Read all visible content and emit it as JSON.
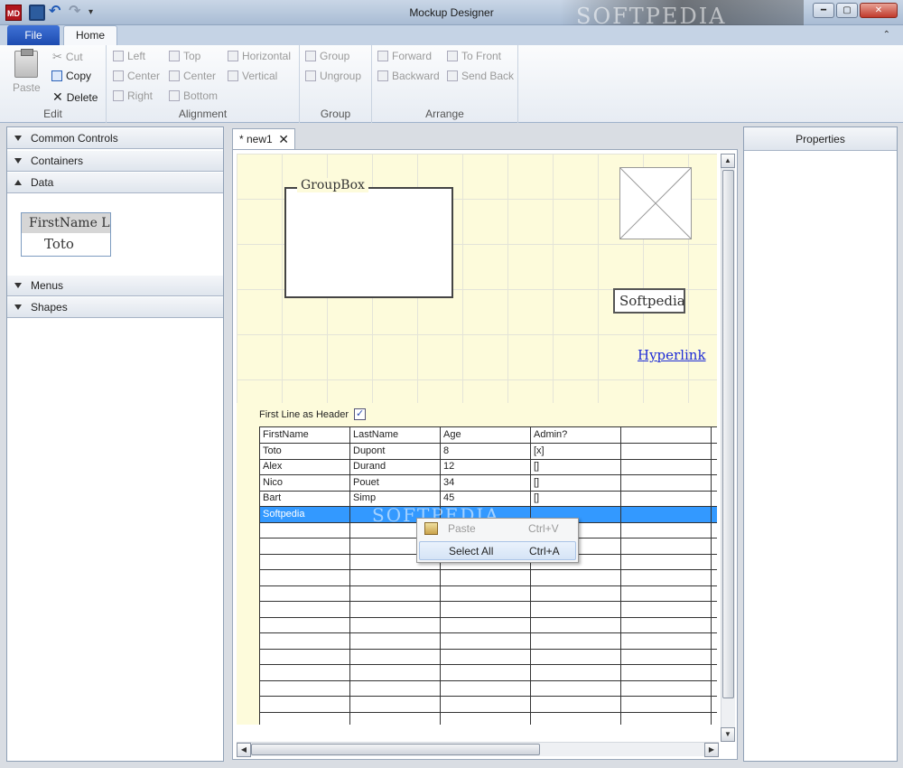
{
  "window": {
    "app_icon": "MD",
    "title": "Mockup Designer",
    "watermark": "SOFTPEDIA",
    "buttons": [
      "minimize",
      "maximize",
      "close"
    ]
  },
  "ribbon": {
    "tabs": [
      "File",
      "Home"
    ],
    "active_tab": "Home",
    "groups": {
      "edit": {
        "label": "Edit",
        "paste": "Paste",
        "cut": "Cut",
        "copy": "Copy",
        "delete": "Delete"
      },
      "alignment": {
        "label": "Alignment",
        "left": "Left",
        "center_h": "Center",
        "right": "Right",
        "top": "Top",
        "center_v": "Center",
        "bottom": "Bottom",
        "horizontal": "Horizontal",
        "vertical": "Vertical"
      },
      "group": {
        "label": "Group",
        "group": "Group",
        "ungroup": "Ungroup"
      },
      "arrange": {
        "label": "Arrange",
        "forward": "Forward",
        "backward": "Backward",
        "to_front": "To Front",
        "send_back": "Send Back"
      }
    }
  },
  "toolbox": {
    "sections": [
      "Common Controls",
      "Containers",
      "Data",
      "Menus",
      "Shapes"
    ],
    "expanded": "Data",
    "data_preview": {
      "header": "FirstName  L",
      "row": "Toto"
    }
  },
  "document": {
    "tab_label": "* new1",
    "tab_close": "✕",
    "groupbox_label": "GroupBox",
    "label_text": "Softpedia",
    "hyperlink_text": "Hyperlink",
    "first_line_header_label": "First Line as Header",
    "first_line_header_checked": true,
    "check_mark": "✓",
    "grid": {
      "rows": [
        [
          "FirstName",
          "LastName",
          "Age",
          "Admin?",
          ""
        ],
        [
          "Toto",
          "Dupont",
          "8",
          "[x]",
          ""
        ],
        [
          "Alex",
          "Durand",
          "12",
          "[]",
          ""
        ],
        [
          "Nico",
          "Pouet",
          "34",
          "[]",
          ""
        ],
        [
          "Bart",
          "Simp",
          "45",
          "[]",
          ""
        ],
        [
          "Softpedia",
          "",
          "",
          "",
          ""
        ]
      ],
      "selected_row": 5
    }
  },
  "context_menu": {
    "items": [
      {
        "label": "Paste",
        "shortcut": "Ctrl+V",
        "enabled": false
      },
      {
        "label": "Select All",
        "shortcut": "Ctrl+A",
        "enabled": true
      }
    ]
  },
  "properties": {
    "title": "Properties"
  }
}
